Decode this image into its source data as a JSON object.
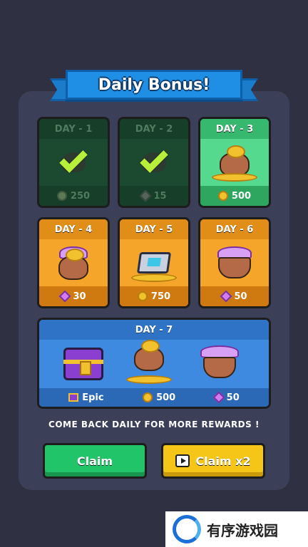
{
  "title": "Daily Bonus!",
  "days": [
    {
      "label": "DAY - 1",
      "amount": "250",
      "reward": "coin",
      "state": "claimed"
    },
    {
      "label": "DAY - 2",
      "amount": "15",
      "reward": "gem",
      "state": "claimed"
    },
    {
      "label": "DAY - 3",
      "amount": "500",
      "reward": "coin",
      "state": "today"
    },
    {
      "label": "DAY - 4",
      "amount": "30",
      "reward": "gem",
      "state": "future"
    },
    {
      "label": "DAY - 5",
      "amount": "750",
      "reward": "coin",
      "state": "future"
    },
    {
      "label": "DAY - 6",
      "amount": "50",
      "reward": "gem",
      "state": "future"
    }
  ],
  "day7": {
    "label": "DAY - 7",
    "rewards": [
      {
        "amount": "Epic",
        "reward": "chest"
      },
      {
        "amount": "500",
        "reward": "coin"
      },
      {
        "amount": "50",
        "reward": "gem"
      }
    ]
  },
  "hint": "COME BACK DAILY FOR MORE REWARDS !",
  "buttons": {
    "claim": "Claim",
    "claim_x2": "Claim x2"
  },
  "watermark": "有序游戏园",
  "colors": {
    "background": "#2f3142",
    "panel": "#3b3f57",
    "banner": "#1f8fe6",
    "claim": "#22c46a",
    "claim_x2": "#f5c518"
  }
}
